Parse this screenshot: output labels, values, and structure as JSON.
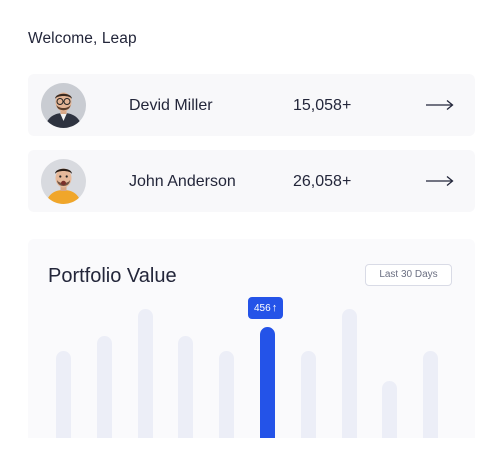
{
  "header": {
    "welcome": "Welcome, Leap"
  },
  "users": [
    {
      "name": "Devid Miller",
      "count": "15,058+",
      "arrow": "⟶",
      "avatar_icon": "person-glasses-avatar"
    },
    {
      "name": "John Anderson",
      "count": "26,058+",
      "arrow": "⟶",
      "avatar_icon": "person-surprised-avatar"
    }
  ],
  "portfolio": {
    "title": "Portfolio Value",
    "range_label": "Last 30 Days",
    "tooltip_value": "456",
    "tooltip_icon": "↑"
  },
  "chart_data": {
    "type": "bar",
    "active_index": 5,
    "active_value": 456,
    "values": [
      0.62,
      0.73,
      0.92,
      0.73,
      0.62,
      0.79,
      0.62,
      0.92,
      0.41,
      0.62
    ],
    "active_color": "#2453e8",
    "bar_color": "#eceef7",
    "note_values": "relative bar heights; only the highlighted bar's value is printed"
  },
  "colors": {
    "accent": "#2453e8",
    "card_bg": "#f8f8fa",
    "text": "#23263a"
  }
}
